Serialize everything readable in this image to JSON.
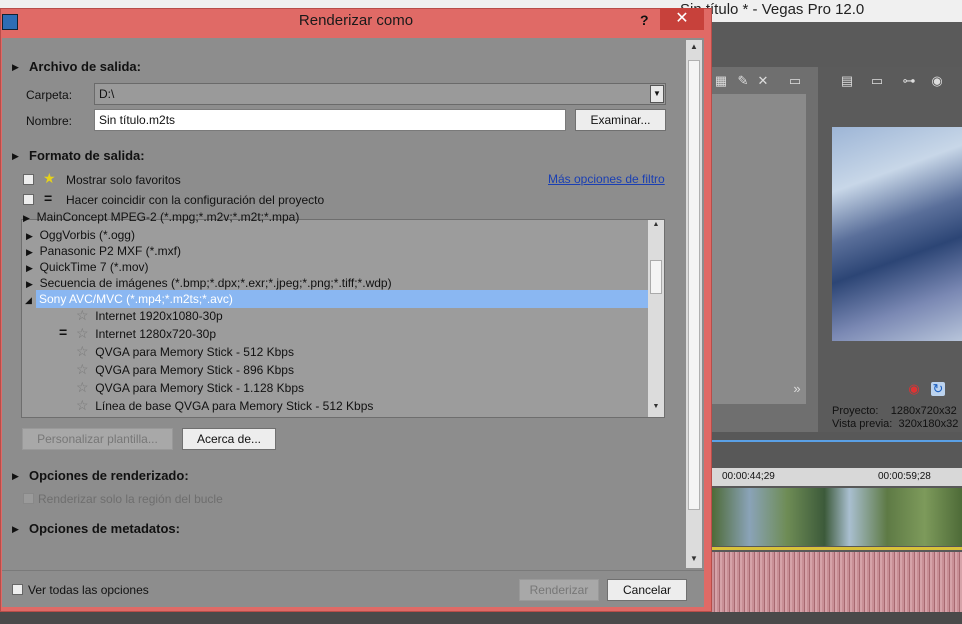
{
  "background_app": {
    "title": "Sin título * - Vegas Pro 12.0",
    "info": {
      "proyecto_label": "Proyecto:",
      "proyecto_value": "1280x720x32",
      "vista_label": "Vista previa:",
      "vista_value": "320x180x32"
    },
    "timecodes": [
      "00:00:44;29",
      "00:00:59;28"
    ]
  },
  "dialog": {
    "title": "Renderizar como",
    "help": "?",
    "close": "✕",
    "archivo": {
      "heading": "Archivo de salida:",
      "carpeta_label": "Carpeta:",
      "carpeta_value": "D:\\",
      "nombre_label": "Nombre:",
      "nombre_value": "Sin título.m2ts",
      "examinar": "Examinar..."
    },
    "formato": {
      "heading": "Formato de salida:",
      "favoritos": "Mostrar solo favoritos",
      "coincidir": "Hacer coincidir con la configuración del proyecto",
      "mas_opciones": "Más opciones de filtro",
      "tree_top_partial": "MainConcept MPEG-2 (*.mpg;*.m2v;*.m2t;*.mpa)",
      "formats": [
        "OggVorbis (*.ogg)",
        "Panasonic P2 MXF (*.mxf)",
        "QuickTime 7 (*.mov)",
        "Secuencia de imágenes (*.bmp;*.dpx;*.exr;*.jpeg;*.png;*.tiff;*.wdp)"
      ],
      "selected_format": "Sony AVC/MVC (*.mp4;*.m2ts;*.avc)",
      "templates": [
        "Internet 1920x1080-30p",
        "Internet 1280x720-30p",
        "QVGA para Memory Stick - 512 Kbps",
        "QVGA para Memory Stick - 896 Kbps",
        "QVGA para Memory Stick - 1.128 Kbps",
        "Línea de base QVGA para Memory Stick - 512 Kbps"
      ],
      "personalizar": "Personalizar plantilla...",
      "acerca": "Acerca de..."
    },
    "render": {
      "heading": "Opciones de renderizado:",
      "bucle": "Renderizar solo la región del bucle"
    },
    "metadatos": {
      "heading": "Opciones de metadatos:"
    },
    "footer": {
      "ver_todas": "Ver todas las opciones",
      "renderizar": "Renderizar",
      "cancelar": "Cancelar"
    }
  }
}
